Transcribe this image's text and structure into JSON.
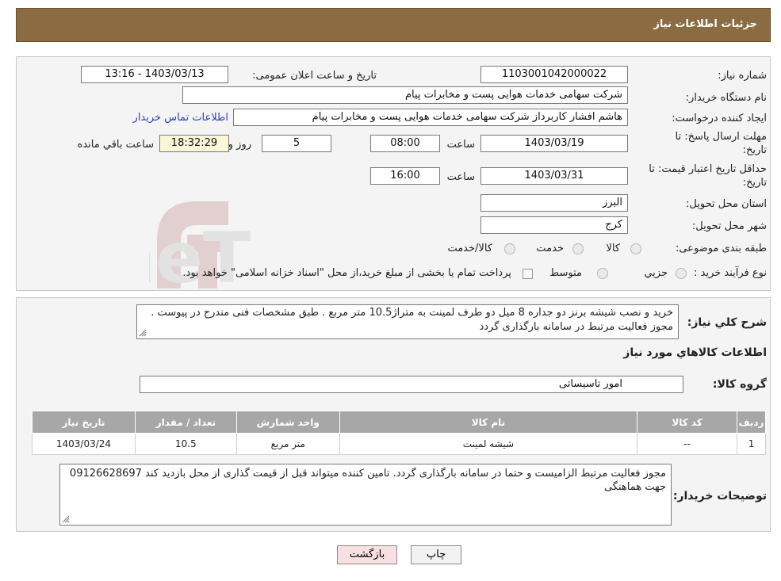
{
  "header": {
    "title": "جزئیات اطلاعات نیاز"
  },
  "form": {
    "need_number_label": "شماره نیاز:",
    "need_number": "1103001042000022",
    "announce_label": "تاریخ و ساعت اعلان عمومی:",
    "announce_value": "1403/03/13 - 13:16",
    "buyer_org_label": "نام دستگاه خریدار:",
    "buyer_org": "شرکت سهامی خدمات هوایی پست و مخابرات پیام",
    "requester_label": "ایجاد کننده درخواست:",
    "requester": "هاشم افشار کاربرداز شرکت سهامی خدمات هوایی پست و مخابرات پیام",
    "contact_link": "اطلاعات تماس خریدار",
    "deadline_label_1": "مهلت ارسال پاسخ: تا",
    "deadline_label_2": "تاریخ:",
    "deadline_date": "1403/03/19",
    "time_label": "ساعت",
    "deadline_time": "08:00",
    "days_value": "5",
    "days_label": "روز و",
    "remaining_time": "18:32:29",
    "remaining_label": "ساعت باقي مانده",
    "validity_label_1": "حداقل تاریخ اعتبار قیمت: تا",
    "validity_label_2": "تاریخ:",
    "validity_date": "1403/03/31",
    "validity_time_label": "ساعت",
    "validity_time": "16:00",
    "province_label": "استان محل تحویل:",
    "province": "البرز",
    "city_label": "شهر محل تحویل:",
    "city": "کرج",
    "category_label": "طبقه بندی موضوعی:",
    "category_options": [
      "کالا",
      "خدمت",
      "کالا/خدمت"
    ],
    "process_label": "نوع فرآیند خرید :",
    "process_options": [
      "جزیي",
      "متوسط"
    ],
    "payment_note": "پرداخت تمام یا بخشی از مبلغ خرید،از محل \"اسناد خزانه اسلامی\" خواهد بود."
  },
  "details": {
    "summary_label": "شرح کلي نیاز:",
    "summary": "خرید و نصب شیشه برنز دو جداره 8 میل دو طرف لمینت به متراژ10.5 متر مربع . طبق مشخصات فنی مندرج در پیوست . مجوز فعالیت  مرتبط در سامانه بارگذاری گردد",
    "goods_info_title": "اطلاعات کالاهاي مورد نياز",
    "group_label": "گروه کالا:",
    "group_value": "امور تاسیساتی",
    "table": {
      "headers": [
        "ردیف",
        "کد کالا",
        "نام کالا",
        "واحد شمارش",
        "تعداد / مقدار",
        "تاریخ نیاز"
      ],
      "rows": [
        [
          "1",
          "--",
          "شیشه لمینت",
          "متر مربع",
          "10.5",
          "1403/03/24"
        ]
      ]
    },
    "buyer_notes_label": "توضیحات خریدار:",
    "buyer_notes": "مجوز فعالیت مرتبط الزامیست و حتما در سامانه بارگذاری گردد. تامین کننده میتواند قبل از قیمت گذاری از محل بازدید کند 09126628697 جهت هماهنگی"
  },
  "buttons": {
    "print": "چاپ",
    "back": "بازگشت"
  },
  "watermark": {
    "text": "AriaTender.neT"
  },
  "colors": {
    "header": "#8b6b42",
    "link": "#2a3fb8",
    "table_header": "#a7a7a7",
    "back_button": "#f9e0e0"
  }
}
